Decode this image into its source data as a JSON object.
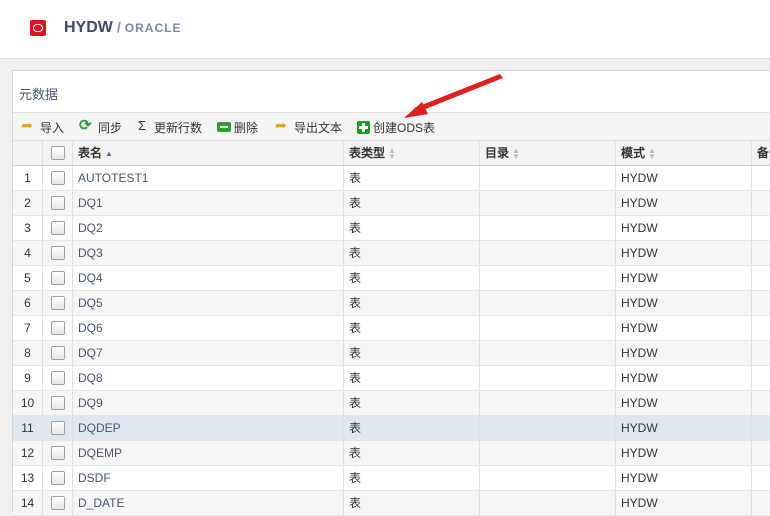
{
  "header": {
    "title": "HYDW",
    "separator": "/",
    "subtitle": "ORACLE"
  },
  "panel": {
    "title": "元数据"
  },
  "toolbar": {
    "import": "导入",
    "sync": "同步",
    "update_rows": "更新行数",
    "delete": "删除",
    "export_text": "导出文本",
    "create_ods": "创建ODS表"
  },
  "columns": {
    "name": "表名",
    "type": "表类型",
    "dir": "目录",
    "mode": "模式",
    "note": "备"
  },
  "rows": [
    {
      "num": "1",
      "name": "AUTOTEST1",
      "type": "表",
      "mode": "HYDW"
    },
    {
      "num": "2",
      "name": "DQ1",
      "type": "表",
      "mode": "HYDW"
    },
    {
      "num": "3",
      "name": "DQ2",
      "type": "表",
      "mode": "HYDW"
    },
    {
      "num": "4",
      "name": "DQ3",
      "type": "表",
      "mode": "HYDW"
    },
    {
      "num": "5",
      "name": "DQ4",
      "type": "表",
      "mode": "HYDW"
    },
    {
      "num": "6",
      "name": "DQ5",
      "type": "表",
      "mode": "HYDW"
    },
    {
      "num": "7",
      "name": "DQ6",
      "type": "表",
      "mode": "HYDW"
    },
    {
      "num": "8",
      "name": "DQ7",
      "type": "表",
      "mode": "HYDW"
    },
    {
      "num": "9",
      "name": "DQ8",
      "type": "表",
      "mode": "HYDW"
    },
    {
      "num": "10",
      "name": "DQ9",
      "type": "表",
      "mode": "HYDW"
    },
    {
      "num": "11",
      "name": "DQDEP",
      "type": "表",
      "mode": "HYDW"
    },
    {
      "num": "12",
      "name": "DQEMP",
      "type": "表",
      "mode": "HYDW"
    },
    {
      "num": "13",
      "name": "DSDF",
      "type": "表",
      "mode": "HYDW"
    },
    {
      "num": "14",
      "name": "D_DATE",
      "type": "表",
      "mode": "HYDW"
    }
  ],
  "colors": {
    "logo": "#e0141e",
    "title": "#3b4a6b",
    "selected_row": "#dfe8ef",
    "annotation_arrow": "#e02020"
  }
}
